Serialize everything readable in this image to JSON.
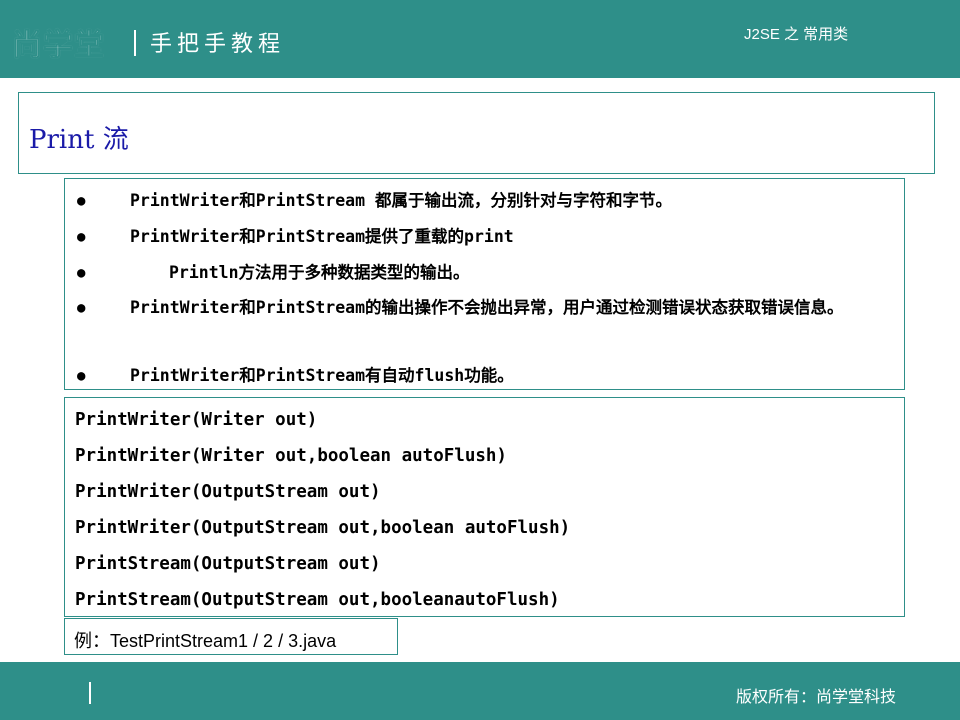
{
  "header": {
    "logo": "尚学堂",
    "tagline": "手把手教程",
    "section": "J2SE 之 常用类"
  },
  "title": "Print 流",
  "bullets": [
    {
      "text": "PrintWriter和PrintStream 都属于输出流，分别针对与字符和字节。"
    },
    {
      "text": "PrintWriter和PrintStream提供了重载的print"
    },
    {
      "text": "Println方法用于多种数据类型的输出。"
    },
    {
      "text": "PrintWriter和PrintStream的输出操作不会抛出异常，用户通过检测错误状态获取错误信息。"
    },
    {
      "text": "PrintWriter和PrintStream有自动flush功能。"
    }
  ],
  "code_lines": [
    "PrintWriter(Writer out)",
    "PrintWriter(Writer out,boolean autoFlush)",
    "PrintWriter(OutputStream out)",
    "PrintWriter(OutputStream out,boolean autoFlush)",
    "PrintStream(OutputStream out)",
    "PrintStream(OutputStream out,booleanautoFlush)"
  ],
  "example": "例：TestPrintStream1 / 2 / 3.java",
  "footer": {
    "copyright": "版权所有：尚学堂科技"
  },
  "colors": {
    "accent": "#2e8f89",
    "title": "#1a1aa8"
  }
}
